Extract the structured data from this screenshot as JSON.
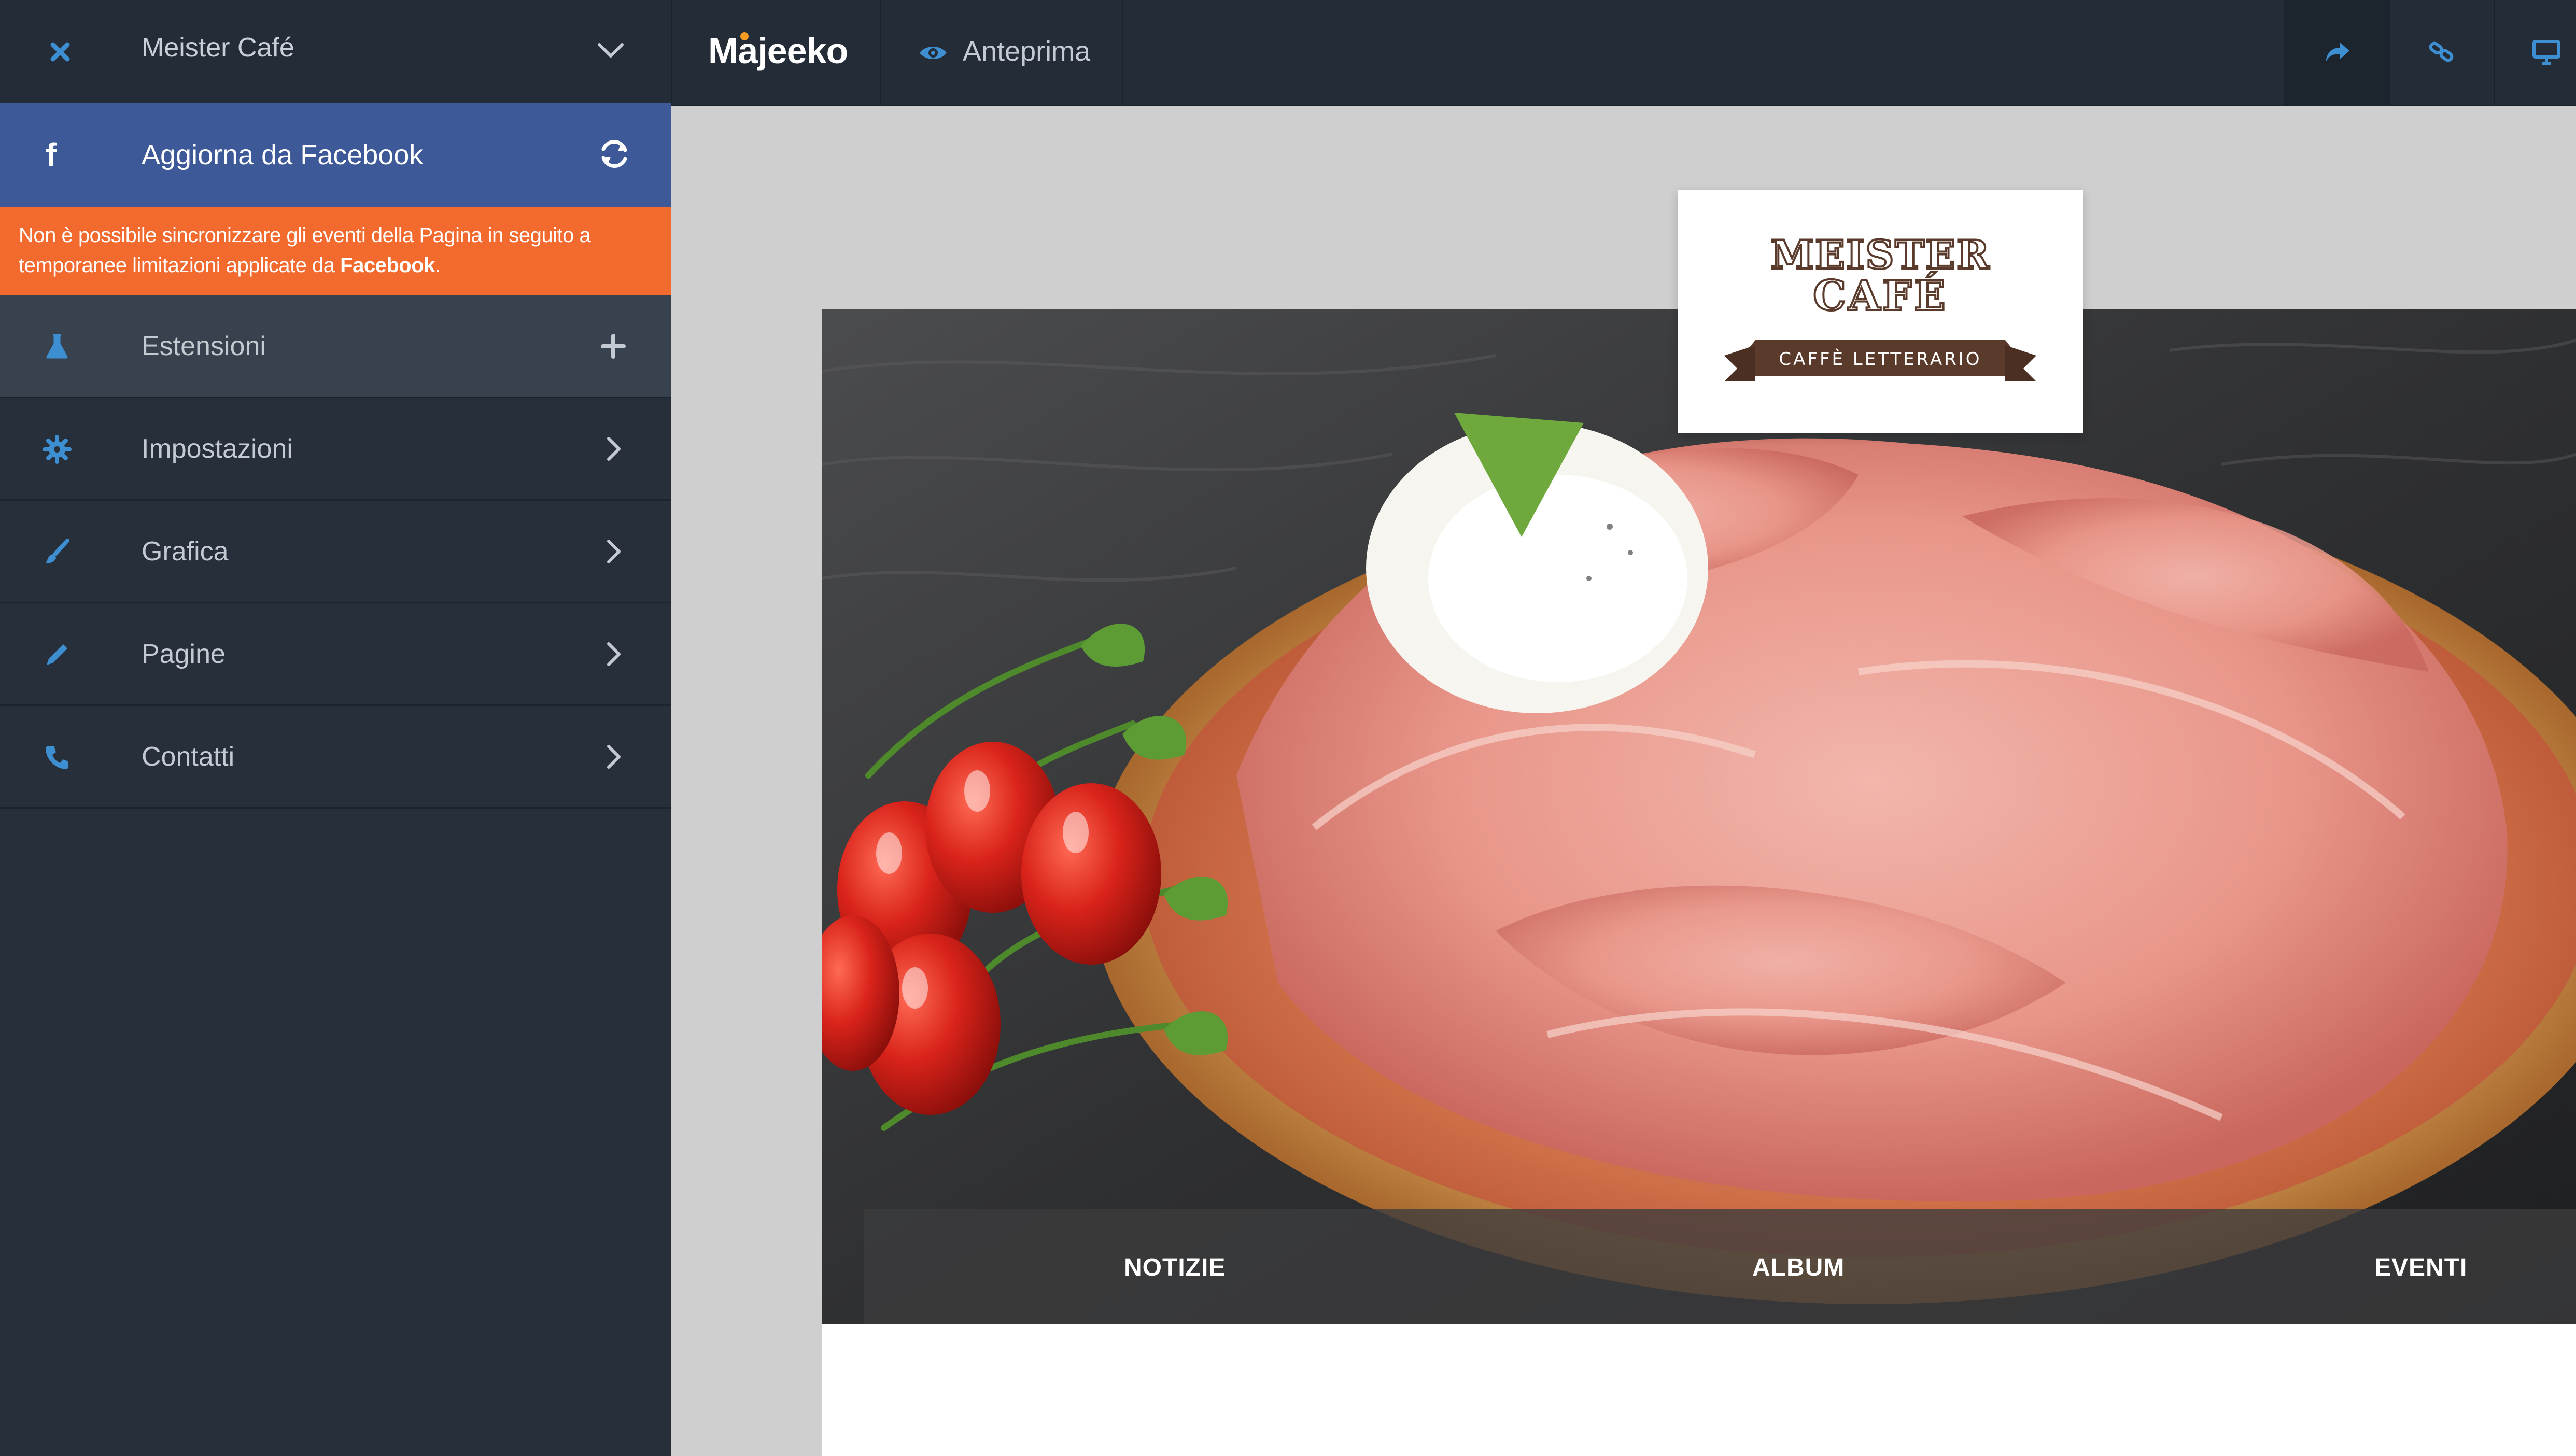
{
  "sidebar": {
    "site_name": "Meister Café",
    "facebook_sync_label": "Aggiorna da Facebook",
    "warning_text_prefix": "Non è possibile sincronizzare gli eventi della Pagina in seguito a temporanee limitazioni applicate da ",
    "warning_text_brand": "Facebook",
    "warning_text_suffix": ".",
    "items": [
      {
        "label": "Estensioni",
        "icon": "flask-icon",
        "action": "plus-icon"
      },
      {
        "label": "Impostazioni",
        "icon": "gear-icon",
        "action": "chevron-right-icon"
      },
      {
        "label": "Grafica",
        "icon": "brush-icon",
        "action": "chevron-right-icon"
      },
      {
        "label": "Pagine",
        "icon": "pencil-icon",
        "action": "chevron-right-icon"
      },
      {
        "label": "Contatti",
        "icon": "phone-icon",
        "action": "chevron-right-icon"
      }
    ]
  },
  "topbar": {
    "brand": "Majeeko",
    "preview_label": "Anteprima",
    "icons": [
      "share-icon",
      "link-icon",
      "desktop-icon"
    ]
  },
  "site_preview": {
    "logo": {
      "line1": "MEISTER",
      "line2": "CAFÉ",
      "ribbon": "CAFFÈ LETTERARIO"
    },
    "nav": [
      "NOTIZIE",
      "ALBUM",
      "EVENTI"
    ]
  },
  "colors": {
    "sidebar_bg": "#262f3a",
    "facebook_blue": "#3d5998",
    "warning_orange": "#f26a2e",
    "brand_accent": "#f59a23",
    "logo_brown": "#5a3a2a"
  }
}
